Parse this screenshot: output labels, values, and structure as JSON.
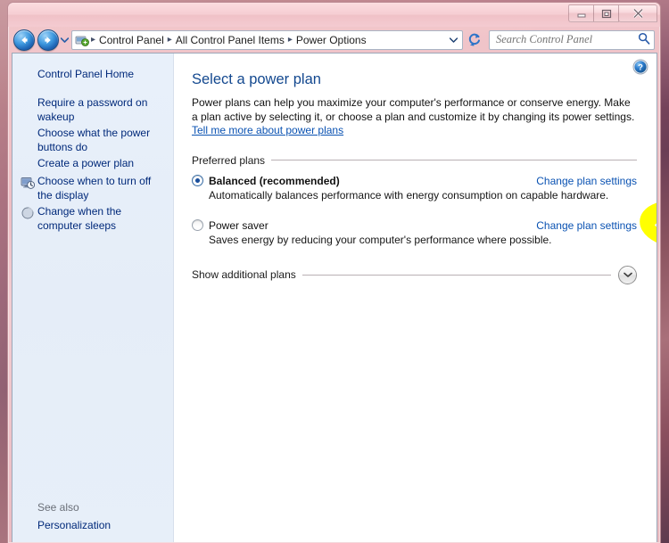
{
  "window": {
    "title": "",
    "controls": {
      "minimize_label": "Minimize",
      "maximize_label": "Maximize",
      "close_label": "Close"
    }
  },
  "navbar": {
    "back_label": "Back",
    "forward_label": "Forward",
    "recent_pages_label": "Recent pages",
    "breadcrumbs": [
      "Control Panel",
      "All Control Panel Items",
      "Power Options"
    ],
    "separator": "▸",
    "refresh_label": "Refresh",
    "previous_locations_label": "Previous locations"
  },
  "search": {
    "placeholder": "Search Control Panel",
    "value": ""
  },
  "sidebar": {
    "home_label": "Control Panel Home",
    "items": [
      {
        "label": "Require a password on wakeup",
        "icon": ""
      },
      {
        "label": "Choose what the power buttons do",
        "icon": ""
      },
      {
        "label": "Create a power plan",
        "icon": ""
      },
      {
        "label": "Choose when to turn off the display",
        "icon": "display-clock-icon"
      },
      {
        "label": "Change when the computer sleeps",
        "icon": "sleep-moon-icon"
      }
    ],
    "see_also_title": "See also",
    "see_also_items": [
      {
        "label": "Personalization"
      }
    ]
  },
  "content": {
    "help_label": "Help",
    "title": "Select a power plan",
    "description_part1": "Power plans can help you maximize your computer's performance or conserve energy. Make a plan active by selecting it, or choose a plan and customize it by changing its power settings. ",
    "description_link": "Tell me more about power plans",
    "preferred_plans_label": "Preferred plans",
    "plans": [
      {
        "name": "Balanced (recommended)",
        "description": "Automatically balances performance with energy consumption on capable hardware.",
        "selected": true,
        "change_link": "Change plan settings",
        "highlighted": true
      },
      {
        "name": "Power saver",
        "description": "Saves energy by reducing your computer's performance where possible.",
        "selected": false,
        "change_link": "Change plan settings",
        "highlighted": false
      }
    ],
    "show_additional_label": "Show additional plans",
    "expand_icon": "chevron-down-icon"
  },
  "colors": {
    "accent_link": "#0a52b2",
    "title_blue": "#13488f",
    "sidebar_link": "#00297a",
    "sidebar_bg": "#e5edf8",
    "frame_pink": "#f0c1c6",
    "marker_yellow": "#ffff00"
  }
}
